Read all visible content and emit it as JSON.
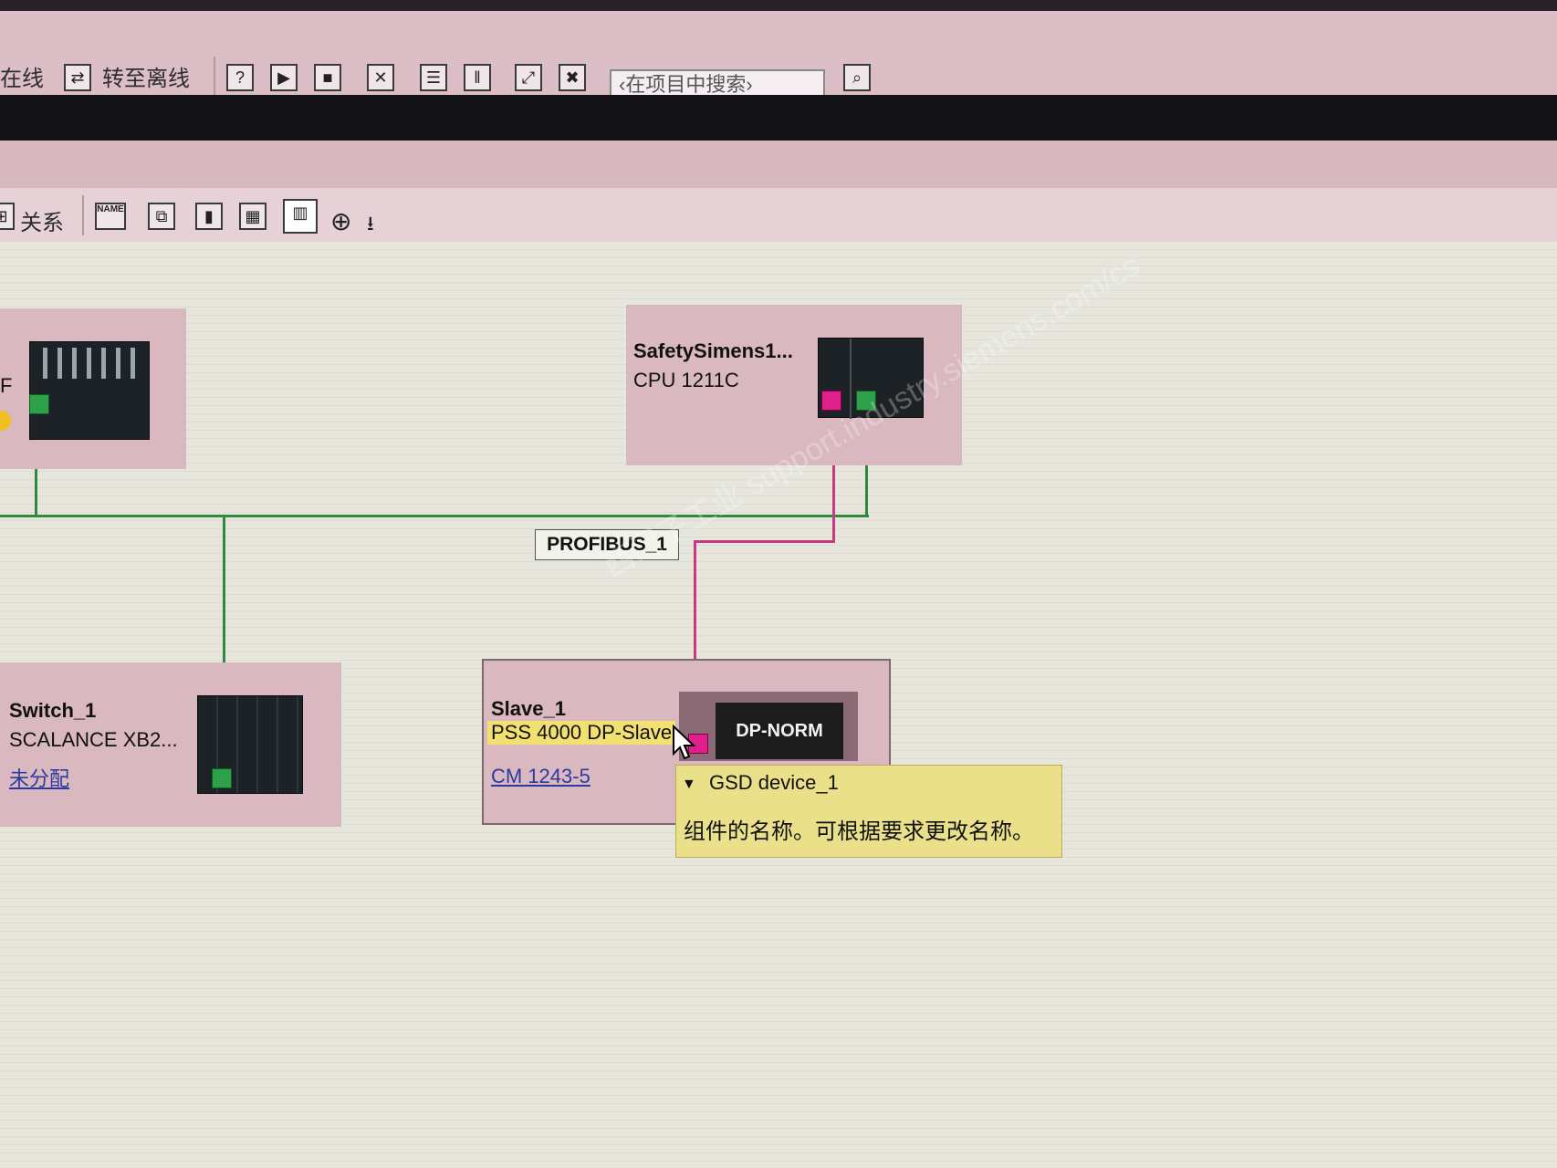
{
  "toolbar1": {
    "go_online": "在线",
    "go_offline": "转至离线",
    "search_placeholder": "‹在项目中搜索›"
  },
  "toolbar2": {
    "relations_label": "关系",
    "name_icon_text": "NAME"
  },
  "network": {
    "bus_label": "PROFIBUS_1",
    "left_device_fragment": "F",
    "devices": {
      "safety": {
        "name": "SafetySimens1...",
        "type": "CPU 1211C"
      },
      "switch": {
        "name": "Switch_1",
        "type": "SCALANCE XB2...",
        "link": "未分配"
      },
      "slave": {
        "name": "Slave_1",
        "type": "PSS 4000 DP-Slave",
        "link": "CM 1243-5",
        "module": "DP-NORM"
      }
    },
    "tooltip": {
      "title": "GSD device_1",
      "description": "组件的名称。可根据要求更改名称。"
    },
    "watermark": "西门子工业 support.industry.siemens.com/cs"
  },
  "colors": {
    "device_bg": "#d9b8c0",
    "ethernet": "#2f8a3e",
    "profibus": "#c83a86",
    "tooltip_bg": "#ebe08a"
  }
}
